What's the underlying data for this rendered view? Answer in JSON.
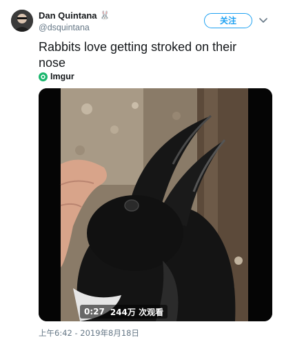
{
  "user": {
    "display_name": "Dan Quintana",
    "name_emoji": "🐰",
    "handle": "@dsquintana",
    "follow_label": "关注"
  },
  "tweet": {
    "text": "Rabbits love getting stroked on their nose",
    "source_label": "Imgur",
    "timestamp": "上午6:42 - 2019年8月18日"
  },
  "video": {
    "duration": "0:27",
    "view_count": "244万 次观看"
  },
  "colors": {
    "accent": "#1da1f2",
    "text": "#14171a",
    "muted": "#657786",
    "imgur_green": "#1bb76e"
  },
  "icons": [
    "avatar",
    "rabbit-emoji",
    "chevron-down-icon",
    "imgur-icon"
  ]
}
